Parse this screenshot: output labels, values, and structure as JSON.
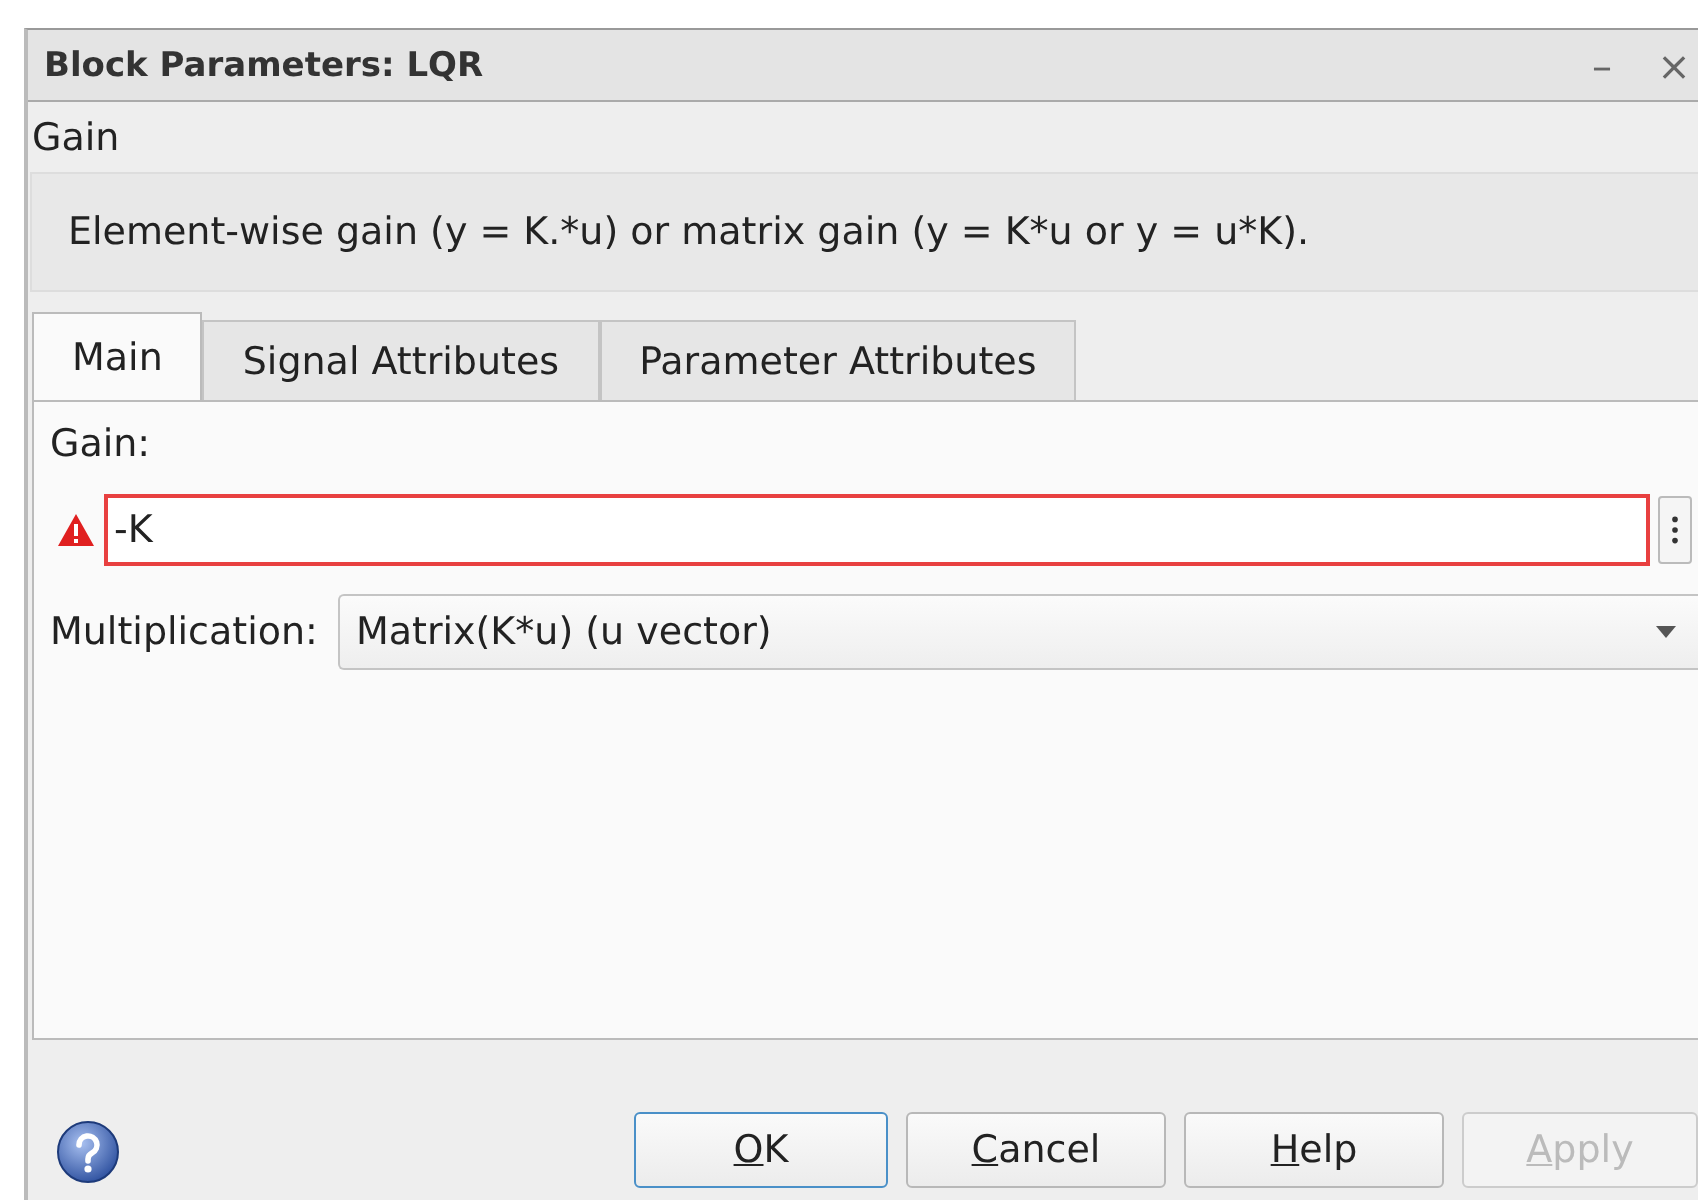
{
  "window": {
    "title": "Block Parameters: LQR",
    "controls": [
      "–",
      "×"
    ]
  },
  "block_type": "Gain",
  "description": "Element-wise gain (y = K.*u) or matrix gain (y = K*u or y = u*K).",
  "tabs": [
    {
      "label": "Main",
      "selected": true
    },
    {
      "label": "Signal Attributes",
      "selected": false
    },
    {
      "label": "Parameter Attributes",
      "selected": false
    }
  ],
  "gain": {
    "label": "Gain:",
    "value": "-K",
    "error": true
  },
  "multiplication": {
    "label": "Multiplication:",
    "value": "Matrix(K*u) (u vector)"
  },
  "buttons": [
    {
      "label": "OK",
      "default": true,
      "disabled": false
    },
    {
      "label": "Cancel",
      "default": false,
      "disabled": false
    },
    {
      "label": "Help",
      "default": false,
      "disabled": false
    },
    {
      "label": "Apply",
      "default": false,
      "disabled": true
    }
  ]
}
